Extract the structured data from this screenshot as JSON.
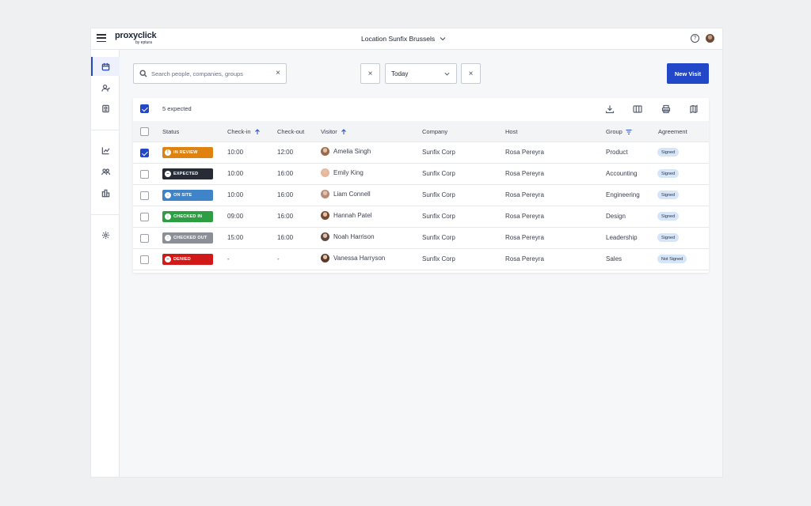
{
  "header": {
    "logo_main": "proxyclick",
    "logo_sub": "by eptura",
    "location": "Location Sunfix Brussels"
  },
  "filters": {
    "search_placeholder": "Search people, companies, groups",
    "date_value": "Today",
    "new_visit_label": "New Visit"
  },
  "table": {
    "expected_count": "5 expected",
    "columns": [
      "Status",
      "Check-in",
      "Check-out",
      "Visitor",
      "Company",
      "Host",
      "Group",
      "Agreement"
    ],
    "rows": [
      {
        "status": "IN REVIEW",
        "status_color": "#e0820f",
        "glyph": "!",
        "checked": true,
        "checkin": "10:00",
        "checkout": "12:00",
        "visitor": "Amelia Singh",
        "company": "Sunfix Corp",
        "host": "Rosa Pereyra",
        "group": "Product",
        "agreement": "Signed"
      },
      {
        "status": "EXPECTED",
        "status_color": "#262b36",
        "glyph": "–",
        "checked": false,
        "checkin": "10:00",
        "checkout": "16:00",
        "visitor": "Emily King",
        "company": "Sunfix Corp",
        "host": "Rosa Pereyra",
        "group": "Accounting",
        "agreement": "Signed"
      },
      {
        "status": "ON SITE",
        "status_color": "#3f83c9",
        "glyph": "↓",
        "checked": false,
        "checkin": "10:00",
        "checkout": "16:00",
        "visitor": "Liam Connell",
        "company": "Sunfix Corp",
        "host": "Rosa Pereyra",
        "group": "Engineering",
        "agreement": "Signed"
      },
      {
        "status": "CHECKED IN",
        "status_color": "#2e9e43",
        "glyph": "↓",
        "checked": false,
        "checkin": "09:00",
        "checkout": "16:00",
        "visitor": "Hannah Patel",
        "company": "Sunfix Corp",
        "host": "Rosa Pereyra",
        "group": "Design",
        "agreement": "Signed"
      },
      {
        "status": "CHECKED OUT",
        "status_color": "#8b8f97",
        "glyph": "↑",
        "checked": false,
        "checkin": "15:00",
        "checkout": "16:00",
        "visitor": "Noah Harrison",
        "company": "Sunfix Corp",
        "host": "Rosa Pereyra",
        "group": "Leadership",
        "agreement": "Signed"
      },
      {
        "status": "DENIED",
        "status_color": "#d11919",
        "glyph": "–",
        "checked": false,
        "checkin": "-",
        "checkout": "-",
        "visitor": "Vanessa Harryson",
        "company": "Sunfix Corp",
        "host": "Rosa Pereyra",
        "group": "Sales",
        "agreement": "Not Signed"
      }
    ]
  },
  "colors": {
    "accent": "#2248c9",
    "badge_bg": "#d7e5f8"
  },
  "icons": [
    "menu-icon",
    "help-icon",
    "avatar",
    "calendar-icon",
    "user-check-icon",
    "badge-icon",
    "chart-icon",
    "users-icon",
    "building-icon",
    "gear-icon",
    "search-icon",
    "download-icon",
    "columns-icon",
    "print-icon",
    "map-icon",
    "sort-up-icon",
    "filter-icon"
  ]
}
